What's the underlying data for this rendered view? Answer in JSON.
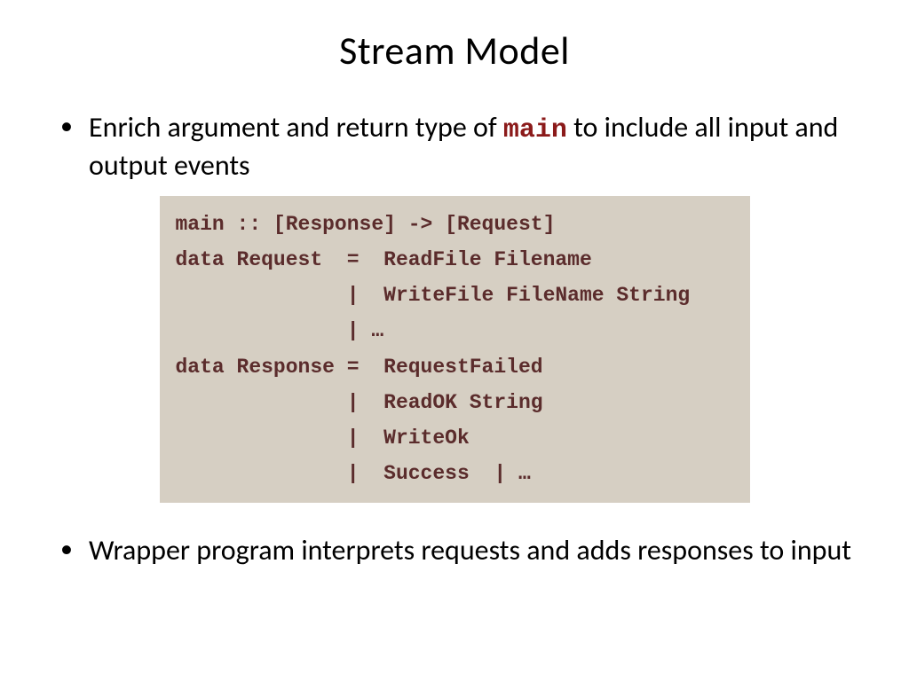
{
  "title": "Stream Model",
  "bullet1_part1": "Enrich argument and return type of ",
  "bullet1_code": "main",
  "bullet1_part2": " to include all input and output events",
  "code": {
    "line1": "main :: [Response] -> [Request]",
    "line2": "data Request  =  ReadFile Filename",
    "line3": "              |  WriteFile FileName String",
    "line4": "              | …",
    "line5": "data Response =  RequestFailed",
    "line6": "              |  ReadOK String",
    "line7": "              |  WriteOk",
    "line8": "              |  Success  | …"
  },
  "bullet2": "Wrapper program interprets requests and adds responses to input"
}
